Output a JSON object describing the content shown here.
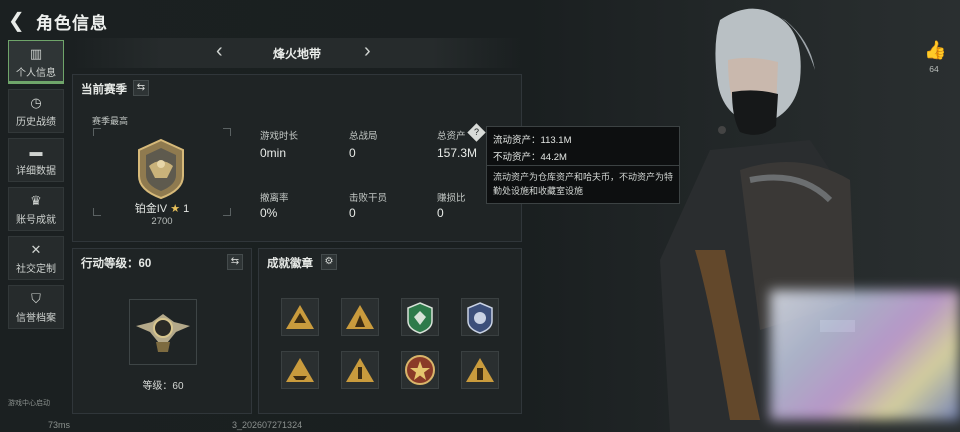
{
  "header": {
    "title": "角色信息",
    "back_icon": "back-arrow-icon"
  },
  "sidebar": {
    "items": [
      {
        "label": "个人信息",
        "icon": "bar-chart-icon",
        "glyph": "▥",
        "active": true
      },
      {
        "label": "历史战绩",
        "icon": "clock-icon",
        "glyph": "◷",
        "active": false
      },
      {
        "label": "详细数据",
        "icon": "folder-icon",
        "glyph": "▬",
        "active": false
      },
      {
        "label": "账号成就",
        "icon": "trophy-icon",
        "glyph": "♛",
        "active": false
      },
      {
        "label": "社交定制",
        "icon": "tools-icon",
        "glyph": "✕",
        "active": false
      },
      {
        "label": "信誉档案",
        "icon": "shield-icon",
        "glyph": "⛉",
        "active": false
      }
    ],
    "footer": "游戏中心启动"
  },
  "map": {
    "name": "烽火地带"
  },
  "season": {
    "header": "当前赛季",
    "sub": "赛季最高",
    "rank_name": "铂金IV",
    "rank_level": "1",
    "rank_points": "2700",
    "stats": [
      {
        "label": "游戏时长",
        "value": "0min"
      },
      {
        "label": "总战局",
        "value": "0"
      },
      {
        "label": "总资产",
        "value": "157.3M"
      },
      {
        "label": "撤离率",
        "value": "0%"
      },
      {
        "label": "击败干员",
        "value": "0"
      },
      {
        "label": "赚损比",
        "value": "0"
      }
    ]
  },
  "tooltip": {
    "liquid": "流动资产：113.1M",
    "fixed": "不动资产：44.2M",
    "desc": "流动资产为仓库资产和哈夫币，不动资产为特勤处设施和收藏室设施"
  },
  "action_level": {
    "header": "行动等级：60",
    "level_text": "等级：60"
  },
  "badges": {
    "header": "成就徽章",
    "items": [
      {
        "icon": "mountain-badge-icon"
      },
      {
        "icon": "tent-badge-icon"
      },
      {
        "icon": "green-shield-badge-icon"
      },
      {
        "icon": "blue-shield-badge-icon"
      },
      {
        "icon": "boat-badge-icon"
      },
      {
        "icon": "number-one-badge-icon"
      },
      {
        "icon": "red-star-badge-icon"
      },
      {
        "icon": "bottle-badge-icon"
      }
    ]
  },
  "likes": {
    "count": "64"
  },
  "status": {
    "ping": "73ms",
    "id_suffix": "3_2026072713​24"
  },
  "colors": {
    "accent": "#6fa56a",
    "gold": "#c9a04a"
  }
}
